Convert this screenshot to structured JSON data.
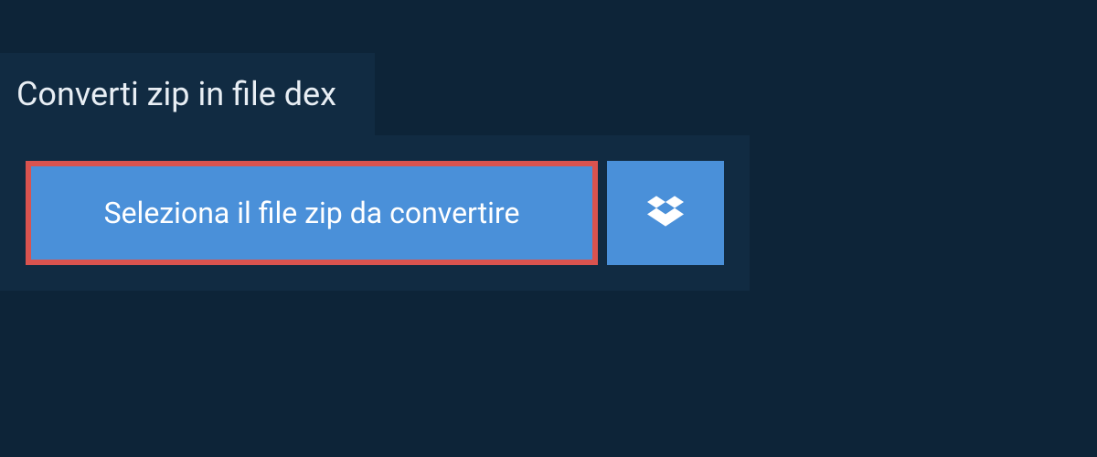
{
  "tab": {
    "title": "Converti zip in file dex"
  },
  "actions": {
    "select_file_label": "Seleziona il file zip da convertire"
  },
  "colors": {
    "background": "#0d2438",
    "panel": "#112b42",
    "button_primary": "#4a90d9",
    "button_highlight_border": "#d9534f",
    "text_light": "#e8eef4"
  }
}
